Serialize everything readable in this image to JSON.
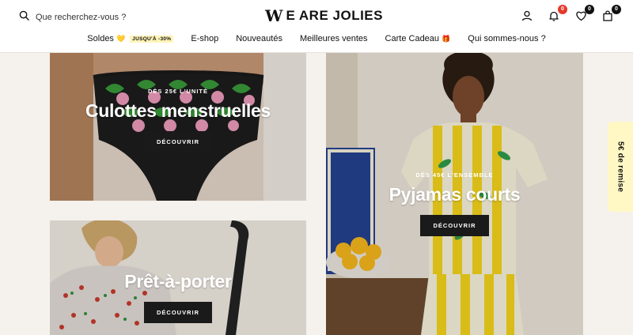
{
  "header": {
    "search_placeholder": "Que recherchez-vous ?",
    "logo_mark": "W",
    "logo_text": "E ARE JOLIES",
    "notification_count": "0",
    "wishlist_count": "0",
    "cart_count": "0"
  },
  "nav": {
    "items": [
      {
        "label": "Soldes",
        "emoji": "💛",
        "pill": "JUSQU'À -30%"
      },
      {
        "label": "E-shop"
      },
      {
        "label": "Nouveautés"
      },
      {
        "label": "Meilleures ventes"
      },
      {
        "label": "Carte Cadeau",
        "emoji": "🎁"
      },
      {
        "label": "Qui sommes-nous ?"
      }
    ]
  },
  "cards": [
    {
      "eyebrow": "DÈS 25€ L'UNITÉ",
      "title": "Culottes menstruelles",
      "cta": "DÉCOUVRIR"
    },
    {
      "eyebrow": "DÈS 45€ L'ENSEMBLE",
      "title": "Pyjamas courts",
      "cta": "DÉCOUVRIR"
    },
    {
      "title": "Prêt-à-porter",
      "cta": "DÉCOUVRIR"
    }
  ],
  "side_tab": {
    "label": "5€ de remise"
  },
  "colors": {
    "accent_badge": "#e5392b",
    "promo_yellow": "#fff4b8",
    "side_tab_bg": "#fff8c5",
    "button_dark": "#1a1a1a"
  },
  "icons": [
    "search-icon",
    "user-icon",
    "bell-icon",
    "heart-icon",
    "bag-icon"
  ]
}
